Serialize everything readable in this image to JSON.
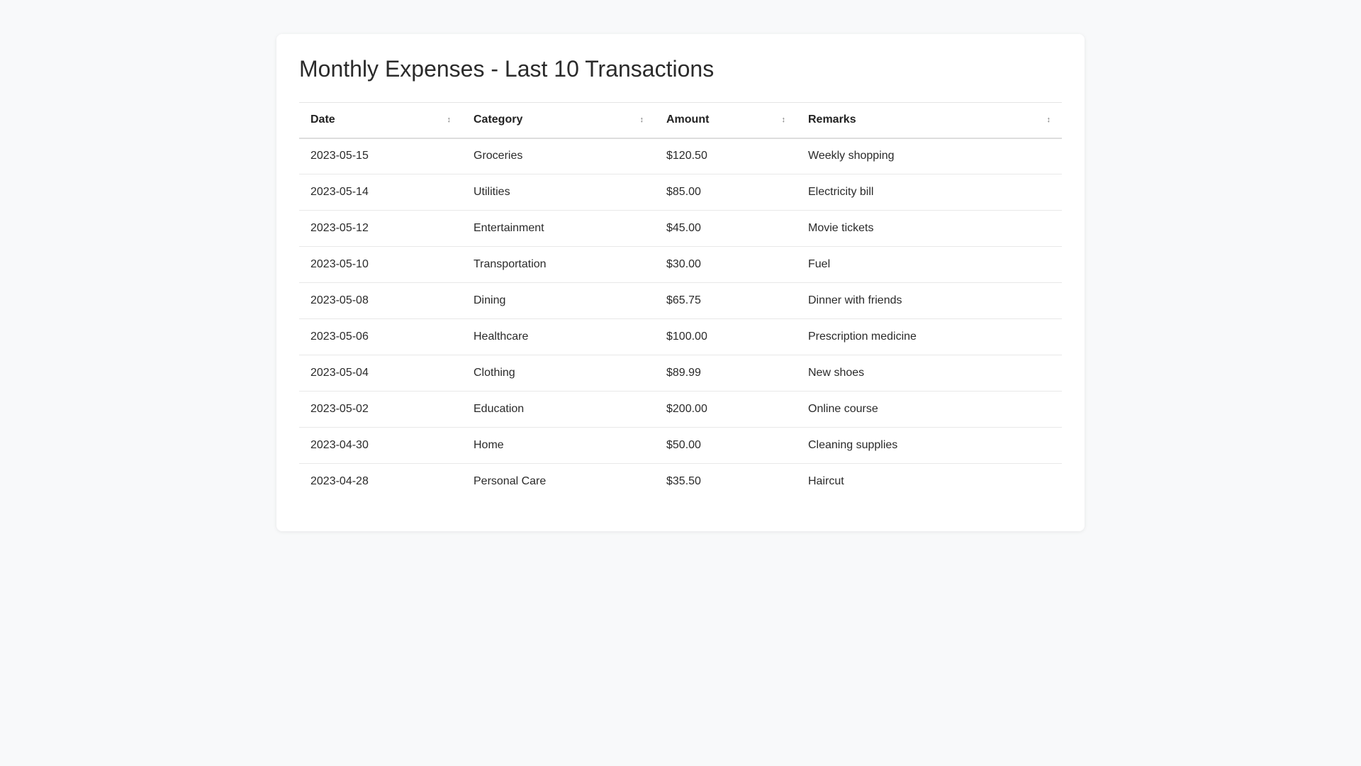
{
  "page": {
    "title": "Monthly Expenses - Last 10 Transactions"
  },
  "table": {
    "columns": [
      {
        "label": "Date",
        "sort_icon": "sort-updown-icon"
      },
      {
        "label": "Category",
        "sort_icon": "sort-updown-icon"
      },
      {
        "label": "Amount",
        "sort_icon": "sort-updown-icon"
      },
      {
        "label": "Remarks",
        "sort_icon": "sort-updown-icon"
      }
    ],
    "sort_glyph": "↕",
    "rows": [
      {
        "date": "2023-05-15",
        "category": "Groceries",
        "amount": "$120.50",
        "remarks": "Weekly shopping"
      },
      {
        "date": "2023-05-14",
        "category": "Utilities",
        "amount": "$85.00",
        "remarks": "Electricity bill"
      },
      {
        "date": "2023-05-12",
        "category": "Entertainment",
        "amount": "$45.00",
        "remarks": "Movie tickets"
      },
      {
        "date": "2023-05-10",
        "category": "Transportation",
        "amount": "$30.00",
        "remarks": "Fuel"
      },
      {
        "date": "2023-05-08",
        "category": "Dining",
        "amount": "$65.75",
        "remarks": "Dinner with friends"
      },
      {
        "date": "2023-05-06",
        "category": "Healthcare",
        "amount": "$100.00",
        "remarks": "Prescription medicine"
      },
      {
        "date": "2023-05-04",
        "category": "Clothing",
        "amount": "$89.99",
        "remarks": "New shoes"
      },
      {
        "date": "2023-05-02",
        "category": "Education",
        "amount": "$200.00",
        "remarks": "Online course"
      },
      {
        "date": "2023-04-30",
        "category": "Home",
        "amount": "$50.00",
        "remarks": "Cleaning supplies"
      },
      {
        "date": "2023-04-28",
        "category": "Personal Care",
        "amount": "$35.50",
        "remarks": "Haircut"
      }
    ]
  }
}
